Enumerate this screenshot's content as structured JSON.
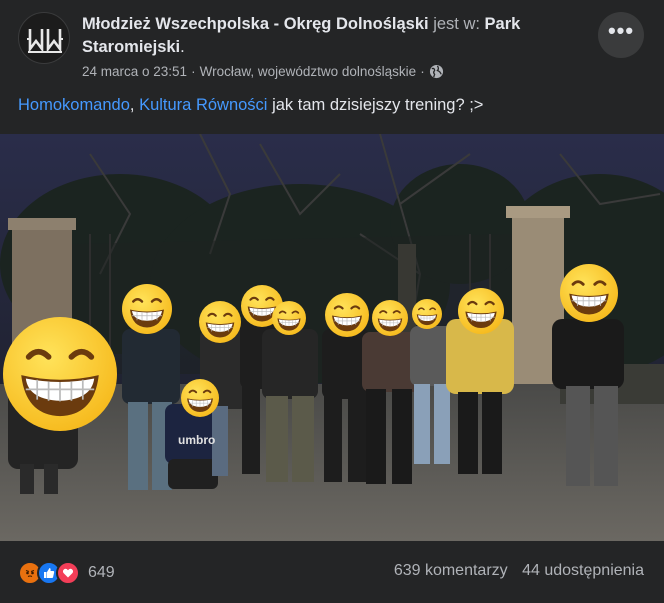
{
  "post": {
    "author": "Młodzież Wszechpolska - Okręg Dolnośląski",
    "connector": "jest w:",
    "place": "Park Staromiejski",
    "place_suffix": ".",
    "date": "24 marca o 23:51",
    "separator": "·",
    "location": "Wrocław, województwo dolnośląskie",
    "separator2": "·",
    "privacy_icon": "globe-icon",
    "more_icon": "more-icon",
    "more_label": "•••",
    "text": {
      "tag1": "Homokomando",
      "comma": ",",
      "tag2": "Kultura Równości",
      "body": "jak tam dzisiejszy trening? ;>"
    },
    "avatar_logo_text": "MW"
  },
  "photo": {
    "description_icon": "group-photo",
    "shirt_text": "umbro",
    "face_overlay_icon": "grinning-face-emoji"
  },
  "footer": {
    "reactions": [
      "angry-reaction-icon",
      "like-reaction-icon",
      "love-reaction-icon"
    ],
    "reaction_count": "649",
    "comments": "639 komentarzy",
    "shares": "44 udostępnienia"
  },
  "colors": {
    "background": "#242526",
    "text": "#e4e6eb",
    "muted": "#b0b3b8",
    "link": "#4599ff"
  }
}
